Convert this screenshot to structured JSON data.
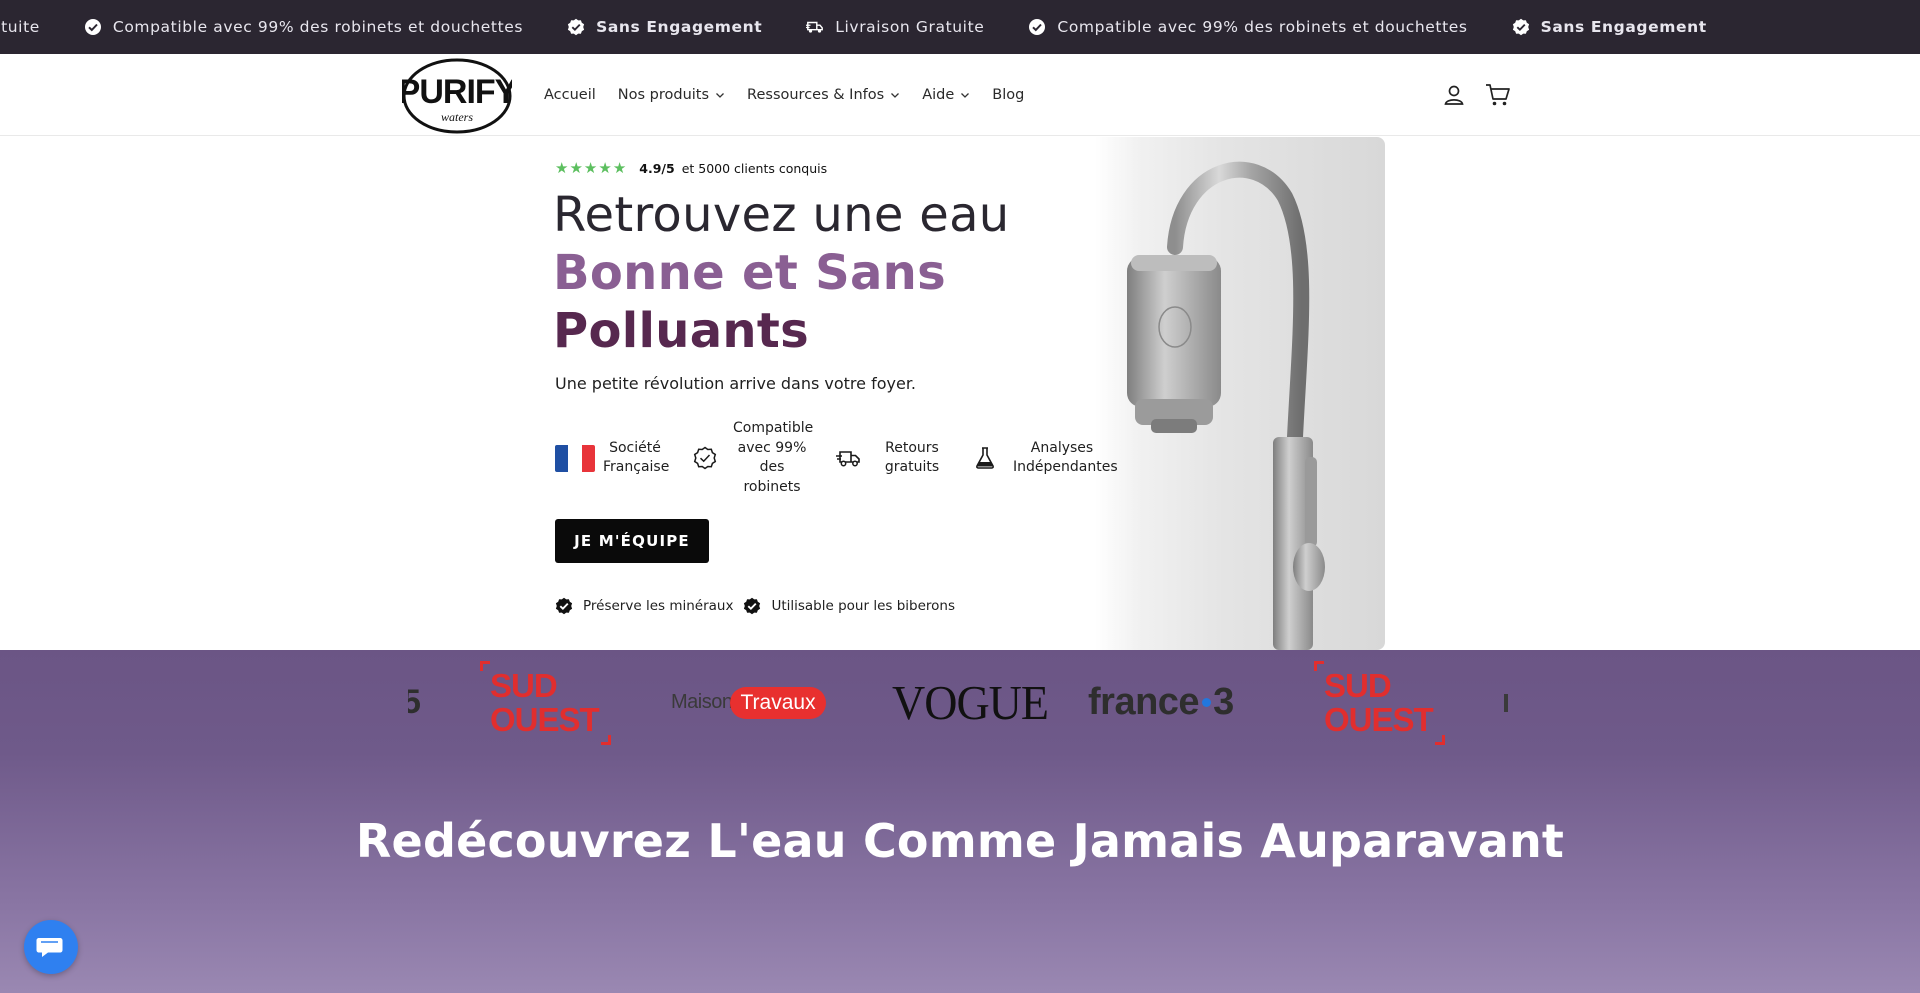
{
  "announcement": {
    "items": [
      {
        "icon": "check-badge-icon",
        "text": "ratuite",
        "bold": false
      },
      {
        "icon": "check-circle-icon",
        "text": "Compatible avec 99% des robinets et douchettes",
        "bold": false
      },
      {
        "icon": "check-badge-icon",
        "text": "Sans Engagement",
        "bold": true
      },
      {
        "icon": "delivery-truck-icon",
        "text": "Livraison Gratuite",
        "bold": false
      },
      {
        "icon": "check-circle-icon",
        "text": "Compatible avec 99% des robinets et douchettes",
        "bold": false
      },
      {
        "icon": "check-badge-icon",
        "text": "Sans Engagement",
        "bold": true
      }
    ]
  },
  "header": {
    "logo_text": "PURIFY",
    "logo_subtext": "waters",
    "nav": [
      {
        "label": "Accueil",
        "has_dropdown": false
      },
      {
        "label": "Nos produits",
        "has_dropdown": true
      },
      {
        "label": "Ressources & Infos",
        "has_dropdown": true
      },
      {
        "label": "Aide",
        "has_dropdown": true
      },
      {
        "label": "Blog",
        "has_dropdown": false
      }
    ],
    "icons": [
      "account-icon",
      "cart-icon"
    ]
  },
  "hero": {
    "rating_stars": 5,
    "rating_score": "4.9/5",
    "rating_text": "et 5000 clients conquis",
    "headline_line1": "Retrouvez une eau",
    "headline_line2": "Bonne et Sans",
    "headline_line3": "Polluants",
    "subtitle": "Une petite révolution arrive dans votre foyer.",
    "features": [
      {
        "icon": "french-flag-icon",
        "text": "Société\nFrançaise"
      },
      {
        "icon": "check-badge-outline-icon",
        "text": "Compatible\navec 99%\ndes\nrobinets"
      },
      {
        "icon": "delivery-truck-icon",
        "text": "Retours\ngratuits"
      },
      {
        "icon": "lab-flask-icon",
        "text": "Analyses\nIndépendantes"
      }
    ],
    "cta_label": "JE M'ÉQUIPE",
    "perks": [
      {
        "icon": "check-badge-icon",
        "text": "Préserve les minéraux"
      },
      {
        "icon": "check-badge-icon",
        "text": "Utilisable pour les biberons"
      }
    ]
  },
  "press": {
    "logos": [
      "SUD OUEST",
      "Maison&Travaux",
      "VOGUE",
      "france.3",
      "SUD OUEST"
    ],
    "maison_part1": "Maison",
    "maison_part2": "Travaux",
    "vogue": "VOGUE",
    "france_part1": "france",
    "france_part2": "3",
    "sud_line1": "SUD",
    "sud_line2": "OUEST"
  },
  "section": {
    "title": "Redécouvrez L'eau Comme Jamais Auparavant"
  },
  "colors": {
    "announcement_bg": "#2b2631",
    "headline_purple_light": "#8a5f93",
    "headline_purple_dark": "#57284f",
    "star_green": "#5cbf5f",
    "press_band": "#6b5585",
    "chat_button": "#2f80f0"
  }
}
